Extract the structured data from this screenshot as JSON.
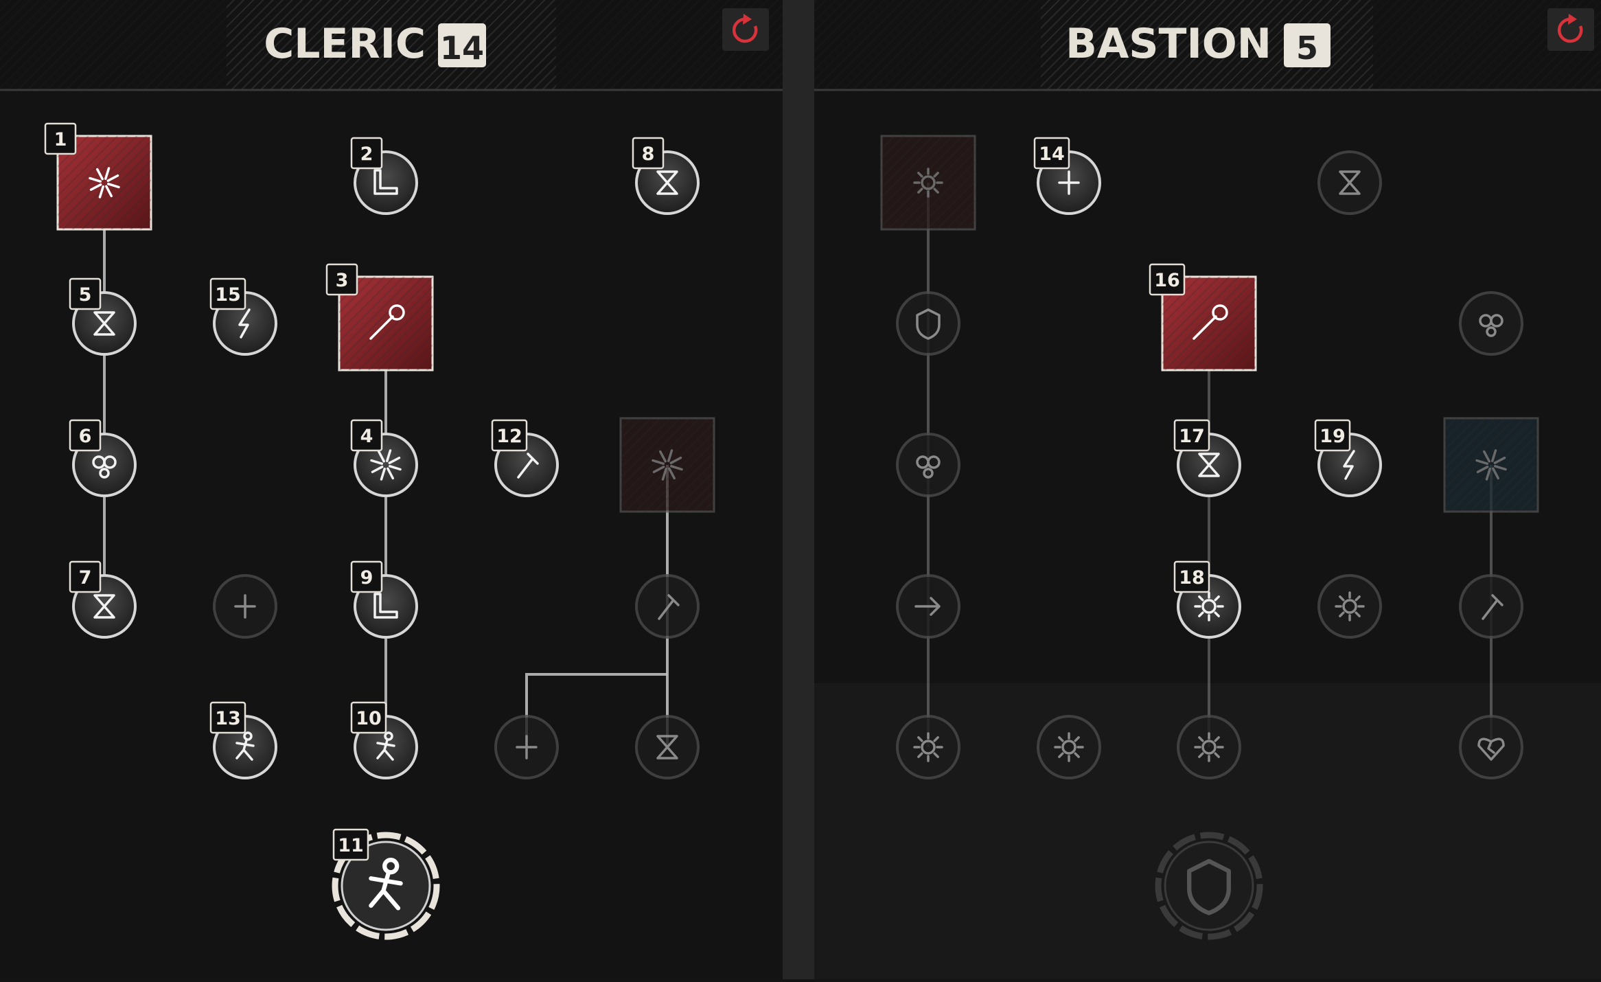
{
  "colors": {
    "background": "#161616",
    "panel": "#131313",
    "divider": "#262626",
    "connector": "#bdbdbd",
    "active_square": "#8e2a2e",
    "reset_icon": "#d8323a",
    "badge": "#e8e4dc"
  },
  "trees": [
    {
      "name": "CLERIC",
      "points": "14",
      "reset_icon": "refresh-icon",
      "ultimate": {
        "order": "11",
        "active": true,
        "icon": "figure-icon"
      },
      "nodes": [
        {
          "order": "1",
          "shape": "square",
          "active": true,
          "icon": "explosion-icon"
        },
        {
          "order": "2",
          "shape": "circle",
          "active": true,
          "icon": "boot-icon"
        },
        {
          "order": "8",
          "shape": "circle",
          "active": true,
          "icon": "hourglass-icon"
        },
        {
          "order": "5",
          "shape": "circle",
          "active": true,
          "icon": "hourglass-icon"
        },
        {
          "order": "15",
          "shape": "circle",
          "active": true,
          "icon": "lightning-icon"
        },
        {
          "order": "3",
          "shape": "square",
          "active": true,
          "icon": "mace-icon"
        },
        {
          "order": "6",
          "shape": "circle",
          "active": true,
          "icon": "gauntlets-icon"
        },
        {
          "order": "4",
          "shape": "circle",
          "active": true,
          "icon": "swirl-icon"
        },
        {
          "order": "12",
          "shape": "circle",
          "active": true,
          "icon": "torch-icon"
        },
        {
          "order": "",
          "shape": "square",
          "active": false,
          "icon": "aura-icon"
        },
        {
          "order": "7",
          "shape": "circle",
          "active": true,
          "icon": "hourglass-icon"
        },
        {
          "order": "",
          "shape": "circle",
          "active": false,
          "icon": "cross-icon"
        },
        {
          "order": "9",
          "shape": "circle",
          "active": true,
          "icon": "boot-icon"
        },
        {
          "order": "",
          "shape": "circle",
          "active": false,
          "icon": "axe-icon"
        },
        {
          "order": "13",
          "shape": "circle",
          "active": true,
          "icon": "running-icon"
        },
        {
          "order": "10",
          "shape": "circle",
          "active": true,
          "icon": "figure-icon"
        },
        {
          "order": "",
          "shape": "circle",
          "active": false,
          "icon": "medical-cross-icon"
        },
        {
          "order": "",
          "shape": "circle",
          "active": false,
          "icon": "hourglass-icon"
        }
      ]
    },
    {
      "name": "BASTION",
      "points": "5",
      "reset_icon": "refresh-icon",
      "ultimate": {
        "order": "",
        "active": false,
        "icon": "shield-icon"
      },
      "nodes": [
        {
          "order": "",
          "shape": "square",
          "active": false,
          "icon": "burst-icon"
        },
        {
          "order": "14",
          "shape": "circle",
          "active": true,
          "icon": "medical-cross-icon"
        },
        {
          "order": "",
          "shape": "circle",
          "active": false,
          "icon": "hourglass-icon"
        },
        {
          "order": "",
          "shape": "circle",
          "active": false,
          "icon": "shield-icon"
        },
        {
          "order": "16",
          "shape": "square",
          "active": true,
          "icon": "chain-mace-icon"
        },
        {
          "order": "",
          "shape": "circle",
          "active": false,
          "icon": "gauntlets-icon"
        },
        {
          "order": "",
          "shape": "circle",
          "active": false,
          "icon": "gauntlets-icon"
        },
        {
          "order": "17",
          "shape": "circle",
          "active": true,
          "icon": "hourglass-icon"
        },
        {
          "order": "19",
          "shape": "circle",
          "active": true,
          "icon": "lightning-icon"
        },
        {
          "order": "",
          "shape": "square",
          "active": false,
          "icon": "sunrise-icon"
        },
        {
          "order": "",
          "shape": "circle",
          "active": false,
          "icon": "arrow-icon"
        },
        {
          "order": "18",
          "shape": "circle",
          "active": true,
          "icon": "burst-icon"
        },
        {
          "order": "",
          "shape": "circle",
          "active": false,
          "icon": "gear-icon"
        },
        {
          "order": "",
          "shape": "circle",
          "active": false,
          "icon": "torch-icon"
        },
        {
          "order": "",
          "shape": "circle",
          "active": false,
          "icon": "sun-icon"
        },
        {
          "order": "",
          "shape": "circle",
          "active": false,
          "icon": "gear-icon"
        },
        {
          "order": "",
          "shape": "circle",
          "active": false,
          "icon": "burst-icon"
        },
        {
          "order": "",
          "shape": "circle",
          "active": false,
          "icon": "broken-heart-icon"
        }
      ]
    }
  ]
}
